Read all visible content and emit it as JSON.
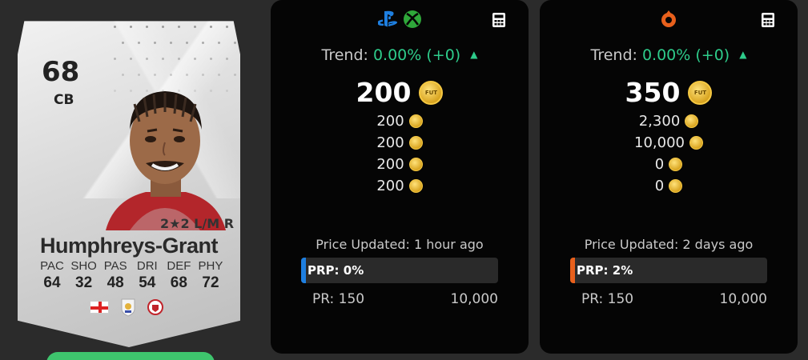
{
  "card": {
    "rating": "68",
    "position": "CB",
    "skills": "2★2 L/M R",
    "name": "Humphreys-Grant",
    "stats": [
      {
        "label": "PAC",
        "value": "64"
      },
      {
        "label": "SHO",
        "value": "32"
      },
      {
        "label": "PAS",
        "value": "48"
      },
      {
        "label": "DRI",
        "value": "54"
      },
      {
        "label": "DEF",
        "value": "68"
      },
      {
        "label": "PHY",
        "value": "72"
      }
    ],
    "badges": [
      "england-flag-icon",
      "league-badge-icon",
      "club-badge-icon"
    ]
  },
  "panels": [
    {
      "platform": "console",
      "icons": [
        "playstation-icon",
        "xbox-icon"
      ],
      "trend_label": "Trend:",
      "trend_value": "0.00% (+0)",
      "main_price": "200",
      "prices": [
        "200",
        "200",
        "200",
        "200"
      ],
      "updated": "Price Updated: 1 hour ago",
      "prp": "PRP: 0%",
      "accent": "#1e7fe0",
      "pr_min": "PR: 150",
      "pr_max": "10,000"
    },
    {
      "platform": "pc",
      "icons": [
        "origin-icon"
      ],
      "trend_label": "Trend:",
      "trend_value": "0.00% (+0)",
      "main_price": "350",
      "prices": [
        "2,300",
        "10,000",
        "0",
        "0"
      ],
      "updated": "Price Updated: 2 days ago",
      "prp": "PRP: 2%",
      "accent": "#e8601c",
      "pr_min": "PR: 150",
      "pr_max": "10,000"
    }
  ],
  "colors": {
    "trend_green": "#2ecc8b",
    "coin_gold": "#f5c842",
    "panel_bg": "#050505",
    "page_bg": "#2b2b2b"
  }
}
